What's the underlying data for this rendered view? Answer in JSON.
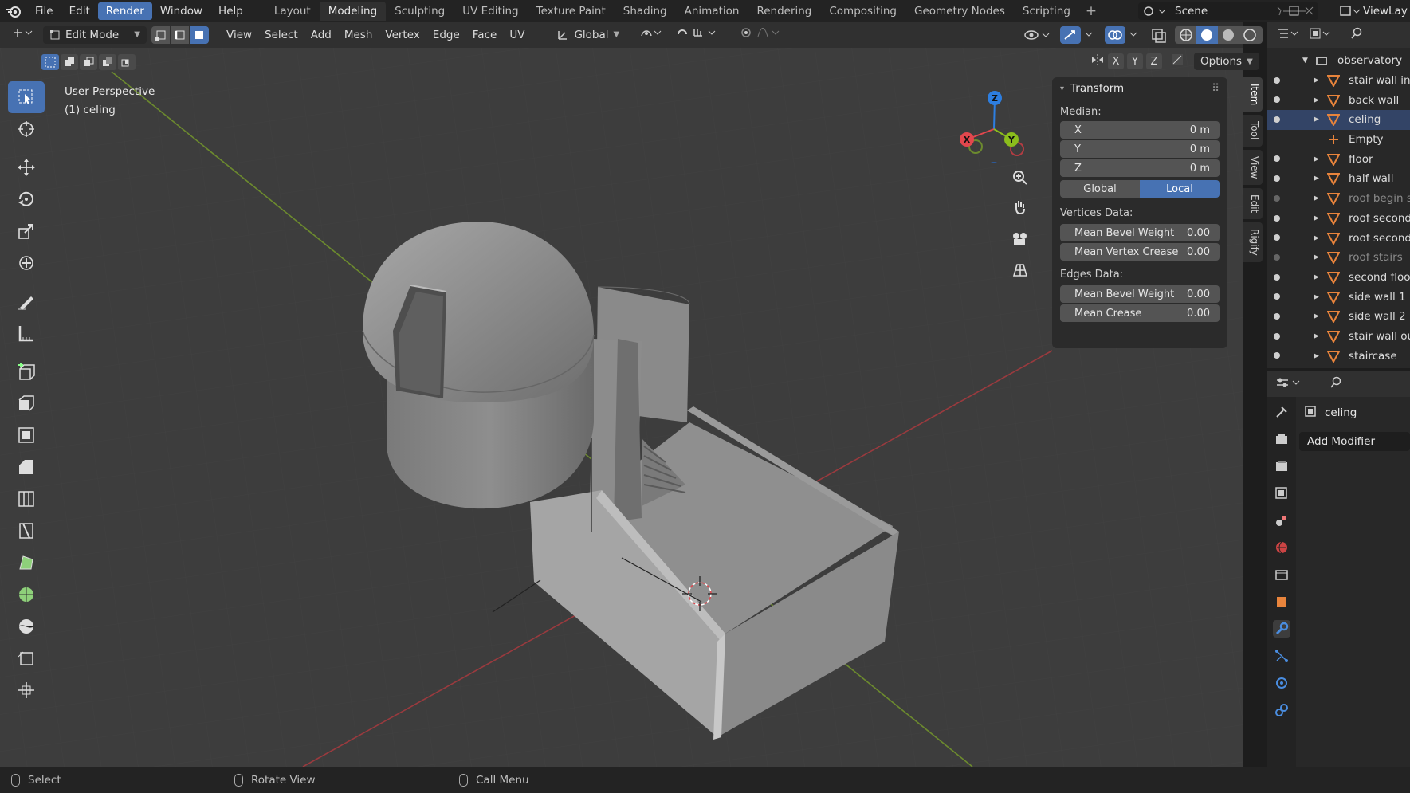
{
  "menu": {
    "items": [
      {
        "label": "File"
      },
      {
        "label": "Edit"
      },
      {
        "label": "Render",
        "active": true
      },
      {
        "label": "Window"
      },
      {
        "label": "Help"
      }
    ]
  },
  "workspaces": [
    {
      "label": "Layout"
    },
    {
      "label": "Modeling",
      "active": true
    },
    {
      "label": "Sculpting"
    },
    {
      "label": "UV Editing"
    },
    {
      "label": "Texture Paint"
    },
    {
      "label": "Shading"
    },
    {
      "label": "Animation"
    },
    {
      "label": "Rendering"
    },
    {
      "label": "Compositing"
    },
    {
      "label": "Geometry Nodes"
    },
    {
      "label": "Scripting"
    }
  ],
  "scene": {
    "name": "Scene"
  },
  "view_layer": {
    "name": "ViewLay"
  },
  "header": {
    "mode": "Edit Mode",
    "menus": [
      "View",
      "Select",
      "Add",
      "Mesh",
      "Vertex",
      "Edge",
      "Face",
      "UV"
    ],
    "orientation": "Global"
  },
  "options_label": "Options",
  "axes": [
    "X",
    "Y",
    "Z"
  ],
  "viewport": {
    "perspective": "User Perspective",
    "object": "(1) celing"
  },
  "gizmo": {
    "x_label": "X",
    "y_label": "Y",
    "z_label": "Z"
  },
  "npanel": {
    "title": "Transform",
    "median_label": "Median:",
    "median": [
      {
        "axis": "X",
        "value": "0 m"
      },
      {
        "axis": "Y",
        "value": "0 m"
      },
      {
        "axis": "Z",
        "value": "0 m"
      }
    ],
    "space": {
      "global": "Global",
      "local": "Local",
      "selected": "Local"
    },
    "vertices_label": "Vertices Data:",
    "vertices": [
      {
        "label": "Mean Bevel Weight",
        "value": "0.00"
      },
      {
        "label": "Mean Vertex Crease",
        "value": "0.00"
      }
    ],
    "edges_label": "Edges Data:",
    "edges": [
      {
        "label": "Mean Bevel Weight",
        "value": "0.00"
      },
      {
        "label": "Mean Crease",
        "value": "0.00"
      }
    ]
  },
  "side_tabs": [
    "Item",
    "Tool",
    "View",
    "Edit",
    "Rigify"
  ],
  "outliner": {
    "collection": "observatory",
    "items": [
      {
        "label": "stair wall in",
        "visible": true
      },
      {
        "label": "back wall",
        "visible": true
      },
      {
        "label": "celing",
        "visible": true,
        "selected": true
      },
      {
        "label": "Empty",
        "visible": false,
        "type": "empty"
      },
      {
        "label": "floor",
        "visible": true
      },
      {
        "label": "half wall",
        "visible": true
      },
      {
        "label": "roof begin s",
        "visible": false
      },
      {
        "label": "roof second",
        "visible": true
      },
      {
        "label": "roof second",
        "visible": true
      },
      {
        "label": "roof stairs",
        "visible": false
      },
      {
        "label": "second floor",
        "visible": true
      },
      {
        "label": "side wall 1",
        "visible": true
      },
      {
        "label": "side wall 2",
        "visible": true
      },
      {
        "label": "stair wall ou",
        "visible": true
      },
      {
        "label": "staircase",
        "visible": true
      }
    ]
  },
  "properties": {
    "object_name": "celing",
    "add_modifier": "Add Modifier"
  },
  "status": {
    "select": "Select",
    "rotate": "Rotate View",
    "menu": "Call Menu"
  },
  "colors": {
    "accent": "#4772b3",
    "x_axis": "#e2474d",
    "y_axis": "#8bbd1c",
    "z_axis": "#2d7ee0",
    "mesh_orange": "#e8843c"
  }
}
